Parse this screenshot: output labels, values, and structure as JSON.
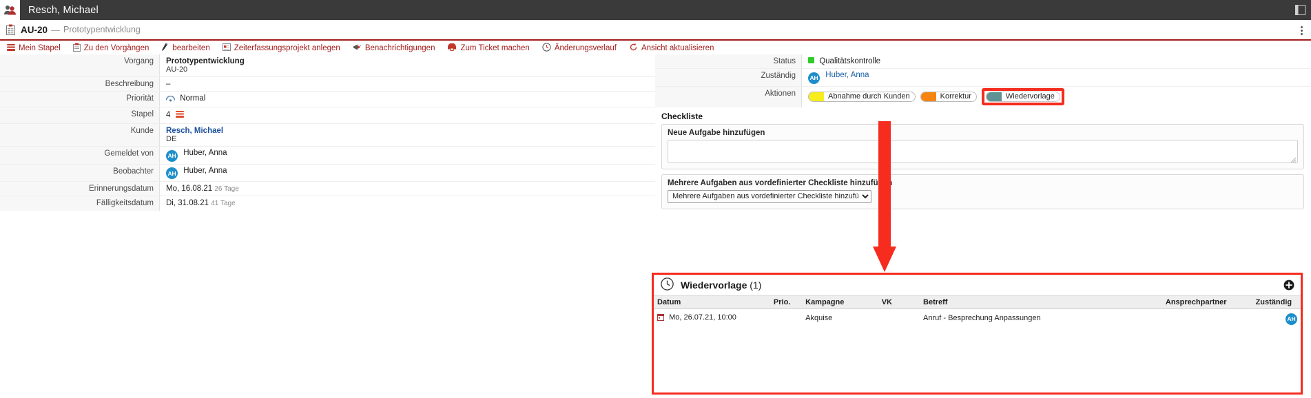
{
  "topbar": {
    "title": "Resch, Michael",
    "icon": "users-icon",
    "right_icon": "panel-toggle-icon"
  },
  "breadcrumb": {
    "icon": "clipboard-icon",
    "key": "AU-20",
    "dash": "—",
    "title": "Prototypentwicklung",
    "menu_icon": "kebab-menu-icon"
  },
  "toolbar": {
    "items": [
      {
        "label": "Mein Stapel",
        "icon": "stack-icon"
      },
      {
        "label": "Zu den Vorgängen",
        "icon": "clipboard-icon"
      },
      {
        "label": "bearbeiten",
        "icon": "pencil-icon"
      },
      {
        "label": "Zeiterfassungsprojekt anlegen",
        "icon": "time-project-icon"
      },
      {
        "label": "Benachrichtigungen",
        "icon": "megaphone-icon"
      },
      {
        "label": "Zum Ticket machen",
        "icon": "ticket-icon"
      },
      {
        "label": "Änderungsverlauf",
        "icon": "clock-history-icon"
      },
      {
        "label": "Ansicht aktualisieren",
        "icon": "refresh-icon"
      }
    ]
  },
  "left_fields": [
    {
      "label": "Vorgang",
      "value": "Prototypentwicklung",
      "sub": "AU-20",
      "style": "bold"
    },
    {
      "label": "Beschreibung",
      "value": "–"
    },
    {
      "label": "Priorität",
      "value": "Normal",
      "icon": "priority-normal-icon"
    },
    {
      "label": "Stapel",
      "value": "4",
      "icon": "stack-icon"
    },
    {
      "label": "Kunde",
      "value": "Resch, Michael",
      "sub": "DE",
      "style": "link-bold"
    },
    {
      "label": "Gemeldet von",
      "value": "Huber, Anna",
      "avatar": "AH"
    },
    {
      "label": "Beobachter",
      "value": "Huber, Anna",
      "avatar": "AH"
    },
    {
      "label": "Erinnerungsdatum",
      "value": "Mo, 16.08.21",
      "note": "26 Tage"
    },
    {
      "label": "Fälligkeitsdatum",
      "value": "Di, 31.08.21",
      "note": "41 Tage"
    }
  ],
  "right_fields": [
    {
      "label": "Status",
      "value": "Qualitätskontrolle",
      "dot_color": "#2ecc28"
    },
    {
      "label": "Zuständig",
      "value": "Huber, Anna",
      "avatar": "AH"
    }
  ],
  "actions": {
    "label": "Aktionen",
    "buttons": [
      {
        "label": "Abnahme durch Kunden",
        "color": "#f7ec1c",
        "highlighted": false
      },
      {
        "label": "Korrektur",
        "color": "#f58410",
        "highlighted": false
      },
      {
        "label": "Wiedervorlage",
        "color": "#5f9292",
        "highlighted": true
      }
    ]
  },
  "checklist": {
    "heading": "Checkliste",
    "new_task_label": "Neue Aufgabe hinzufügen",
    "new_task_value": "",
    "new_task_placeholder": "",
    "predefined_label": "Mehrere Aufgaben aus vordefinierter Checkliste hinzufügen",
    "predefined_selected": "Mehrere Aufgaben aus vordefinierter Checkliste hinzufügen",
    "predefined_options": [
      "Mehrere Aufgaben aus vordefinierter Checkliste hinzufügen"
    ]
  },
  "annotation": {
    "arrow_color": "#f52c1e",
    "arrow_name": "red-arrow-annotation"
  },
  "wiedervorlage_panel": {
    "icon": "clock-icon",
    "title": "Wiedervorlage",
    "count": "(1)",
    "add_icon": "plus-circle-icon",
    "columns": [
      "Datum",
      "Prio.",
      "Kampagne",
      "VK",
      "Betreff",
      "Ansprechpartner",
      "Zuständig"
    ],
    "rows": [
      {
        "datum": "Mo, 26.07.21, 10:00",
        "datum_icon": "calendar-icon",
        "prio": "",
        "kampagne": "Akquise",
        "vk": "",
        "betreff": "Anruf - Besprechung Anpassungen",
        "ansprechpartner": "",
        "zustaendig": "AH"
      }
    ]
  }
}
